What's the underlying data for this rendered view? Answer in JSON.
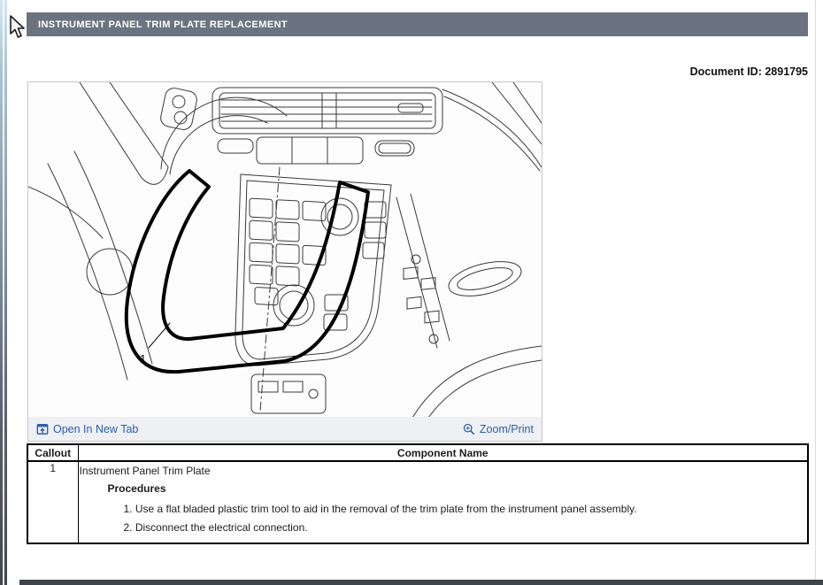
{
  "header": {
    "title": "INSTRUMENT PANEL TRIM PLATE REPLACEMENT",
    "bg_color": "#6b7380"
  },
  "document_id": "Document ID: 2891795",
  "figure": {
    "callout_label": "1",
    "open_link_label": "Open In New Tab",
    "zoom_link_label": "Zoom/Print",
    "link_color": "#2b5fad"
  },
  "component_table": {
    "col_callout": "Callout",
    "col_component": "Component Name",
    "row": {
      "callout": "1",
      "component_name": "Instrument Panel Trim Plate",
      "procedures_heading": "Procedures",
      "steps": [
        "1. Use a flat bladed plastic trim tool to aid in the removal of the trim plate from the instrument panel assembly.",
        "2. Disconnect the electrical connection."
      ]
    }
  }
}
